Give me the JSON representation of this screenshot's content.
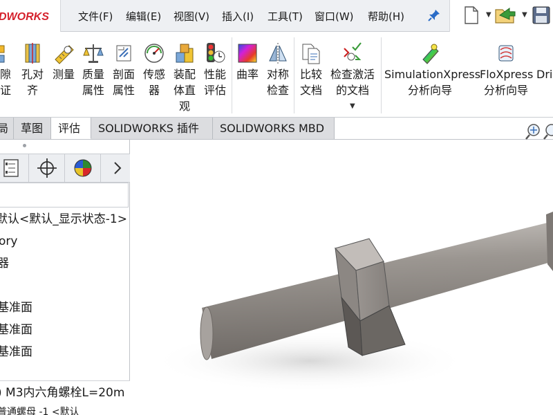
{
  "app": {
    "logo_text": "DWORKS",
    "brand_color": "#d5212c"
  },
  "menu": {
    "items": [
      {
        "label": "文件(F)"
      },
      {
        "label": "编辑(E)"
      },
      {
        "label": "视图(V)"
      },
      {
        "label": "插入(I)"
      },
      {
        "label": "工具(T)"
      },
      {
        "label": "窗口(W)"
      },
      {
        "label": "帮助(H)"
      }
    ]
  },
  "ribbon": {
    "buttons": [
      {
        "label1": "隙",
        "label2": "证",
        "icon": "clearance-verification-icon"
      },
      {
        "label1": "孔对",
        "label2": "齐",
        "icon": "hole-alignment-icon"
      },
      {
        "label1": "测量",
        "label2": "",
        "icon": "measure-icon"
      },
      {
        "label1": "质量",
        "label2": "属性",
        "icon": "mass-properties-icon"
      },
      {
        "label1": "剖面",
        "label2": "属性",
        "icon": "section-properties-icon"
      },
      {
        "label1": "传感",
        "label2": "器",
        "icon": "sensor-icon"
      },
      {
        "label1": "装配",
        "label2": "体直",
        "label3": "观",
        "icon": "assembly-visualization-icon"
      },
      {
        "label1": "性能",
        "label2": "评估",
        "icon": "performance-evaluation-icon"
      },
      {
        "label1": "曲率",
        "label2": "",
        "icon": "curvature-icon"
      },
      {
        "label1": "对称",
        "label2": "检查",
        "icon": "symmetry-check-icon"
      },
      {
        "label1": "比较",
        "label2": "文档",
        "icon": "compare-documents-icon"
      },
      {
        "label1": "检查激活",
        "label2": "的文档",
        "icon": "check-active-document-icon"
      },
      {
        "label1": "SimulationXpress",
        "label2": "分析向导",
        "icon": "simulationxpress-icon"
      },
      {
        "label1": "FloXpress",
        "label2": "分析向导",
        "icon": "floxpress-icon"
      },
      {
        "label1": "Dri",
        "label2": "",
        "icon": "driveworks-icon"
      }
    ]
  },
  "tabs": [
    {
      "label": "局"
    },
    {
      "label": "草图"
    },
    {
      "label": "评估",
      "active": true
    },
    {
      "label": "SOLIDWORKS 插件"
    },
    {
      "label": "SOLIDWORKS MBD"
    }
  ],
  "feature_tree": {
    "items": [
      {
        "label": "默认<默认_显示状态-1>"
      },
      {
        "label": "ory"
      },
      {
        "label": "器"
      },
      {
        "label": "基准面"
      },
      {
        "label": "基准面"
      },
      {
        "label": "基准面"
      },
      {
        "label": ") M3内六角螺栓L=20m"
      },
      {
        "label": "普通螺母 -1 <默认"
      }
    ]
  },
  "colors": {
    "menubar_bg": "#eef0f3",
    "tab_bg": "#dcdde0",
    "bolt_color": "#8f8a86"
  }
}
